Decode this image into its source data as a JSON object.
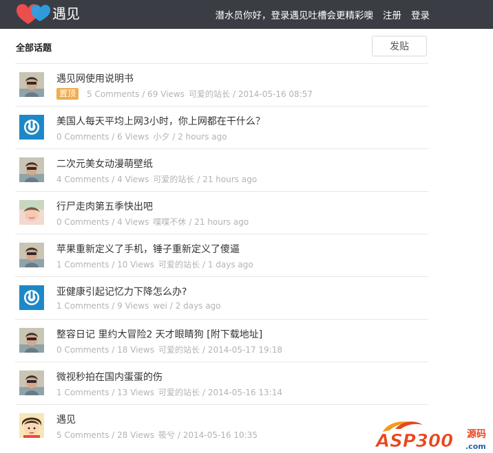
{
  "header": {
    "brand": "遇见",
    "greeting": "潜水员你好，登录遇见吐槽会更精彩噢",
    "register": "注册",
    "login": "登录"
  },
  "section": {
    "title": "全部话题",
    "post_button": "发贴"
  },
  "topics": [
    {
      "title": "遇见网使用说明书",
      "pinned": "置顶",
      "stats": "5 Comments / 69 Views",
      "author": "可爱的站长",
      "time": "/ 2014-05-16 08:57",
      "avatar": "photo"
    },
    {
      "title": "美国人每天平均上网3小时，你上网都在干什么？",
      "stats": "0 Comments / 6 Views",
      "author": "小夕",
      "time": "/ 2 hours ago",
      "avatar": "power"
    },
    {
      "title": "二次元美女动漫萌壁纸",
      "stats": "4 Comments / 4 Views",
      "author": "可爱的站长",
      "time": "/ 21 hours ago",
      "avatar": "photo"
    },
    {
      "title": "行尸走肉第五季快出吧",
      "stats": "0 Comments / 4 Views",
      "author": "喋喋不休",
      "time": "/ 21 hours ago",
      "avatar": "photo2"
    },
    {
      "title": "苹果重新定义了手机，锤子重新定义了傻逼",
      "stats": "1 Comments / 10 Views",
      "author": "可爱的站长",
      "time": "/ 1 days ago",
      "avatar": "photo"
    },
    {
      "title": "亚健康引起记忆力下降怎么办?",
      "stats": "1 Comments / 9 Views",
      "author": "wei",
      "time": "/ 2 days ago",
      "avatar": "power"
    },
    {
      "title": "整容日记 里约大冒险2 天才眼睛狗 [附下载地址]",
      "stats": "0 Comments / 18 Views",
      "author": "可爱的站长",
      "time": "/ 2014-05-17 19:18",
      "avatar": "photo"
    },
    {
      "title": "微视秒拍在国内蛋蛋的伤",
      "stats": "1 Comments / 13 Views",
      "author": "可爱的站长",
      "time": "/ 2014-05-16 13:14",
      "avatar": "photo"
    },
    {
      "title": "遇见",
      "stats": "5 Comments / 28 Views",
      "author": "筱兮",
      "time": "/ 2014-05-16 10:35",
      "avatar": "cartoon"
    }
  ],
  "watermark": {
    "text": "ASP300",
    "suffix": "源码",
    "domain": ".com"
  },
  "colors": {
    "topbar": "#3a3d44",
    "badge": "#f0ad4e",
    "power": "#1e88c7",
    "logo_red": "#ec4d4d",
    "logo_blue": "#2ea0e5"
  }
}
